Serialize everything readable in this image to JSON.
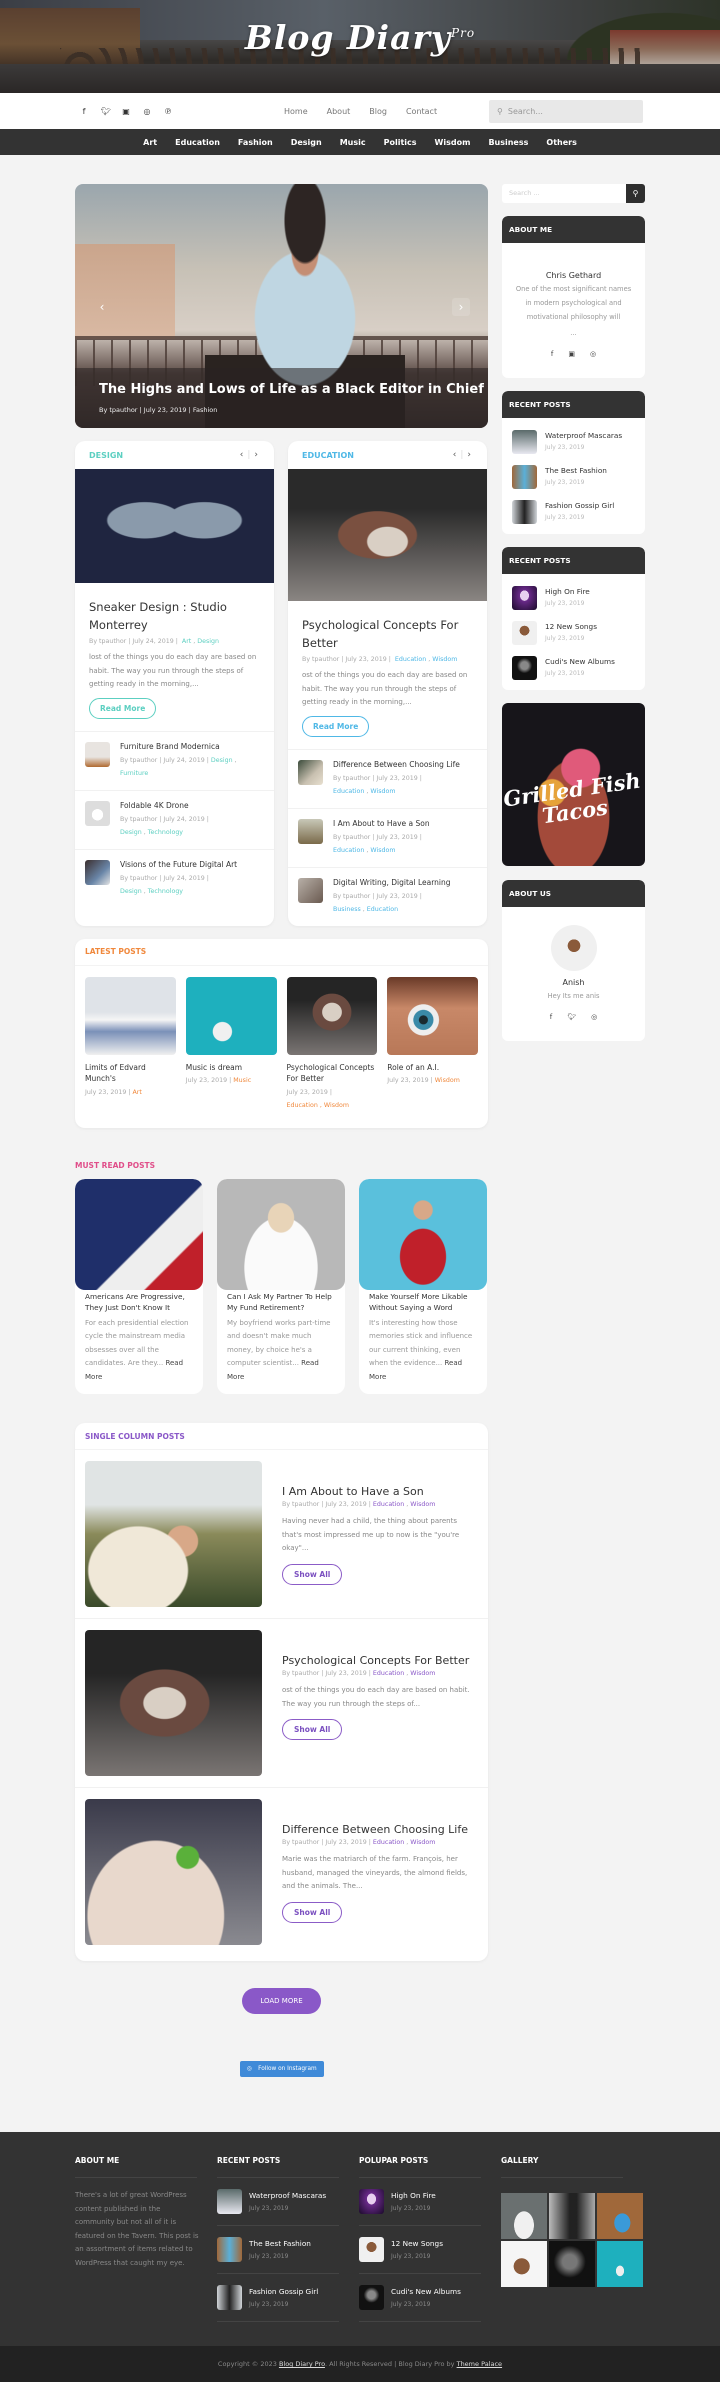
{
  "site": {
    "title": "Blog Diary",
    "title_sup": "Pro"
  },
  "social_icons": [
    "facebook-icon",
    "twitter-icon",
    "youtube-icon",
    "instagram-icon",
    "pinterest-icon"
  ],
  "top_nav": [
    "Home",
    "About",
    "Blog",
    "Contact"
  ],
  "top_search": {
    "placeholder": "Search..."
  },
  "categories": [
    "Art",
    "Education",
    "Fashion",
    "Design",
    "Music",
    "Politics",
    "Wisdom",
    "Business",
    "Others"
  ],
  "colors": {
    "design": "#5ccfc1",
    "education": "#4fb8e6",
    "latest": "#f0883c",
    "must_read": "#e04e8a",
    "single": "#8a58c8",
    "instagram": "#3f8ad8"
  },
  "slider": {
    "title": "The Highs and Lows of Life as a Black Editor in Chief",
    "author": "By tpauthor",
    "date": "July 23, 2019",
    "category": "Fashion",
    "prev": "‹",
    "next": "›"
  },
  "design": {
    "label": "DESIGN",
    "featured": {
      "title": "Sneaker Design : Studio Monterrey",
      "author": "By tpauthor",
      "date": "July 24, 2019",
      "cats": [
        "Art",
        "Design"
      ],
      "excerpt": "lost of the things you do each day are based on habit. The way you run through the steps of getting ready in the morning,...",
      "button": "Read More"
    },
    "list": [
      {
        "title": "Furniture Brand Modernica",
        "author": "By tpauthor",
        "date": "July 24, 2019",
        "cats": [
          "Design",
          "Furniture"
        ]
      },
      {
        "title": "Foldable 4K Drone",
        "author": "By tpauthor",
        "date": "July 24, 2019",
        "cats": [
          "Design",
          "Technology"
        ]
      },
      {
        "title": "Visions of the Future Digital Art",
        "author": "By tpauthor",
        "date": "July 24, 2019",
        "cats": [
          "Design",
          "Technology"
        ]
      }
    ]
  },
  "education": {
    "label": "EDUCATION",
    "featured": {
      "title": "Psychological Concepts For Better",
      "author": "By tpauthor",
      "date": "July 23, 2019",
      "cats": [
        "Education",
        "Wisdom"
      ],
      "excerpt": "ost of the things you do each day are based on habit. The way you run through the steps of getting ready in the morning,...",
      "button": "Read More"
    },
    "list": [
      {
        "title": "Difference Between Choosing Life",
        "author": "By tpauthor",
        "date": "July 23, 2019",
        "cats": [
          "Education",
          "Wisdom"
        ]
      },
      {
        "title": "I Am About to Have a Son",
        "author": "By tpauthor",
        "date": "July 23, 2019",
        "cats": [
          "Education",
          "Wisdom"
        ]
      },
      {
        "title": "Digital Writing, Digital Learning",
        "author": "By tpauthor",
        "date": "July 23, 2019",
        "cats": [
          "Business",
          "Education"
        ]
      }
    ]
  },
  "latest": {
    "label": "LATEST POSTS",
    "posts": [
      {
        "title": "Limits of Edvard Munch's",
        "date": "July 23, 2019",
        "cats": "Art"
      },
      {
        "title": "Music is dream",
        "date": "July 23, 2019",
        "cats": "Music"
      },
      {
        "title": "Psychological Concepts For Better",
        "date": "July 23, 2019",
        "cats": "Education ,  Wisdom"
      },
      {
        "title": "Role of an A.I.",
        "date": "July 23, 2019",
        "cats": "Wisdom"
      }
    ]
  },
  "must_read": {
    "label": "MUST READ POSTS",
    "posts": [
      {
        "title": "Americans Are Progressive, They Just Don't Know It",
        "excerpt": "For each presidential election cycle the mainstream media obsesses over all the candidates. Are they...",
        "more": "Read More"
      },
      {
        "title": "Can I Ask My Partner To Help My Fund Retirement?",
        "excerpt": "My boyfriend works part-time and doesn't make much money, by choice he's a computer scientist...",
        "more": "Read More"
      },
      {
        "title": "Make Yourself More Likable Without Saying a Word",
        "excerpt": "It's interesting how those memories stick and influence our current thinking, even when the evidence...",
        "more": "Read More"
      }
    ]
  },
  "single": {
    "label": "SINGLE COLUMN POSTS",
    "posts": [
      {
        "title": "I Am About to Have a Son",
        "author": "By tpauthor",
        "date": "July 23, 2019",
        "cats": [
          "Education",
          "Wisdom"
        ],
        "excerpt": "Having never had a child, the thing about parents that's most impressed me up to now is the \"you're okay\"...",
        "button": "Show All"
      },
      {
        "title": "Psychological Concepts For Better",
        "author": "By tpauthor",
        "date": "July 23, 2019",
        "cats": [
          "Education",
          "Wisdom"
        ],
        "excerpt": "ost of the things you do each day are based on habit. The way you run through the steps of...",
        "button": "Show All"
      },
      {
        "title": "Difference Between Choosing Life",
        "author": "By tpauthor",
        "date": "July 23, 2019",
        "cats": [
          "Education",
          "Wisdom"
        ],
        "excerpt": "Marie was the matriarch of the farm. François, her husband, managed the vineyards, the almond fields, and the animals. The...",
        "button": "Show All"
      }
    ]
  },
  "load_more": "LOAD MORE",
  "instagram_button": "Follow on Instagram",
  "sidebar": {
    "search_placeholder": "Search ...",
    "about_me": {
      "heading": "ABOUT ME",
      "name": "Chris Gethard",
      "bio": "One of the most significant names in modern psychological and motivational philosophy will",
      "ellipsis": "..."
    },
    "recent1": {
      "heading": "RECENT POSTS",
      "posts": [
        {
          "title": "Waterproof Mascaras",
          "date": "July 23, 2019"
        },
        {
          "title": "The Best Fashion",
          "date": "July 23, 2019"
        },
        {
          "title": "Fashion Gossip Girl",
          "date": "July 23, 2019"
        }
      ]
    },
    "recent2": {
      "heading": "RECENT POSTS",
      "posts": [
        {
          "title": "High On Fire",
          "date": "July 23, 2019"
        },
        {
          "title": "12 New Songs",
          "date": "July 23, 2019"
        },
        {
          "title": "Cudi's New Albums",
          "date": "July 23, 2019"
        }
      ]
    },
    "ad": {
      "line1": "Fish",
      "line2": "Grilled",
      "line3": "Tacos"
    },
    "about_us": {
      "heading": "ABOUT US",
      "name": "Anish",
      "bio": "Hey Its me anis"
    }
  },
  "footer": {
    "about": {
      "heading": "ABOUT ME",
      "text": "There's a lot of great WordPress content published in the community but not all of it is featured on the Tavern. This post is an assortment of items related to WordPress that caught my eye."
    },
    "recent": {
      "heading": "RECENT POSTS",
      "posts": [
        {
          "title": "Waterproof Mascaras",
          "date": "July 23, 2019"
        },
        {
          "title": "The Best Fashion",
          "date": "July 23, 2019"
        },
        {
          "title": "Fashion Gossip Girl",
          "date": "July 23, 2019"
        }
      ]
    },
    "popular": {
      "heading": "POLUPAR POSTS",
      "posts": [
        {
          "title": "High On Fire",
          "date": "July 23, 2019"
        },
        {
          "title": "12 New Songs",
          "date": "July 23, 2019"
        },
        {
          "title": "Cudi's New Albums",
          "date": "July 23, 2019"
        }
      ]
    },
    "gallery": {
      "heading": "GALLERY"
    },
    "copyright_pre": "Copyright © 2023 ",
    "copyright_link1": "Blog Diary Pro",
    "copyright_mid": ". All Rights Reserved | Blog Diary Pro by ",
    "copyright_link2": "Theme Palace"
  }
}
